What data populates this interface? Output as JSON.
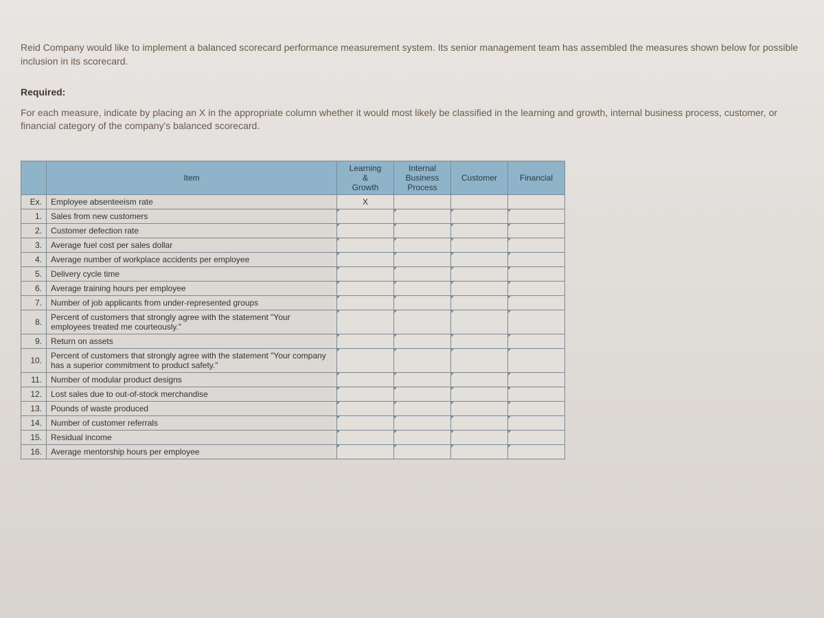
{
  "intro": "Reid Company would like to implement a balanced scorecard performance measurement system. Its senior management team has assembled the measures shown below for possible inclusion in its scorecard.",
  "required_label": "Required:",
  "required_text": "For each measure, indicate by placing an X in the appropriate column whether it would most likely be classified in the learning and growth, internal business process, customer, or financial category of the company's balanced scorecard.",
  "table": {
    "headers": {
      "item": "Item",
      "learning": "Learning & Growth",
      "ibp": "Internal Business Process",
      "customer": "Customer",
      "financial": "Financial"
    },
    "rows": [
      {
        "num": "Ex.",
        "item": "Employee absenteeism rate",
        "learning": "X",
        "ibp": "",
        "customer": "",
        "financial": "",
        "example": true
      },
      {
        "num": "1.",
        "item": "Sales from new customers",
        "learning": "",
        "ibp": "",
        "customer": "",
        "financial": ""
      },
      {
        "num": "2.",
        "item": "Customer defection rate",
        "learning": "",
        "ibp": "",
        "customer": "",
        "financial": ""
      },
      {
        "num": "3.",
        "item": "Average fuel cost per sales dollar",
        "learning": "",
        "ibp": "",
        "customer": "",
        "financial": ""
      },
      {
        "num": "4.",
        "item": "Average number of workplace accidents per employee",
        "learning": "",
        "ibp": "",
        "customer": "",
        "financial": ""
      },
      {
        "num": "5.",
        "item": "Delivery cycle time",
        "learning": "",
        "ibp": "",
        "customer": "",
        "financial": ""
      },
      {
        "num": "6.",
        "item": "Average training hours per employee",
        "learning": "",
        "ibp": "",
        "customer": "",
        "financial": ""
      },
      {
        "num": "7.",
        "item": "Number of job applicants from under-represented groups",
        "learning": "",
        "ibp": "",
        "customer": "",
        "financial": ""
      },
      {
        "num": "8.",
        "item": "Percent of customers that strongly agree with the statement \"Your employees treated me courteously.\"",
        "learning": "",
        "ibp": "",
        "customer": "",
        "financial": ""
      },
      {
        "num": "9.",
        "item": "Return on assets",
        "learning": "",
        "ibp": "",
        "customer": "",
        "financial": ""
      },
      {
        "num": "10.",
        "item": "Percent of customers that strongly agree with the statement \"Your company has a superior commitment to product safety.\"",
        "learning": "",
        "ibp": "",
        "customer": "",
        "financial": ""
      },
      {
        "num": "11.",
        "item": "Number of modular product designs",
        "learning": "",
        "ibp": "",
        "customer": "",
        "financial": ""
      },
      {
        "num": "12.",
        "item": "Lost sales due to out-of-stock merchandise",
        "learning": "",
        "ibp": "",
        "customer": "",
        "financial": ""
      },
      {
        "num": "13.",
        "item": "Pounds of waste produced",
        "learning": "",
        "ibp": "",
        "customer": "",
        "financial": ""
      },
      {
        "num": "14.",
        "item": "Number of customer referrals",
        "learning": "",
        "ibp": "",
        "customer": "",
        "financial": ""
      },
      {
        "num": "15.",
        "item": "Residual income",
        "learning": "",
        "ibp": "",
        "customer": "",
        "financial": ""
      },
      {
        "num": "16.",
        "item": "Average mentorship hours per employee",
        "learning": "",
        "ibp": "",
        "customer": "",
        "financial": ""
      }
    ]
  }
}
